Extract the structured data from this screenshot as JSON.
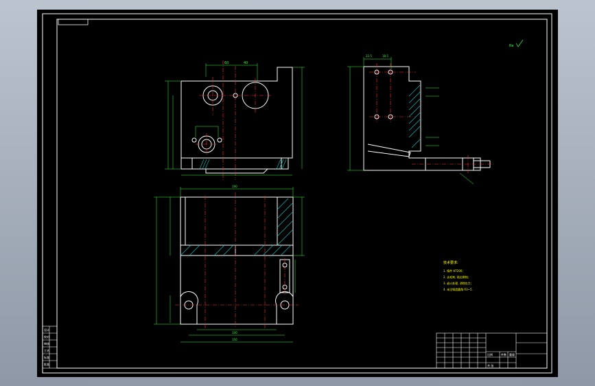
{
  "colors": {
    "background": "#000000",
    "frame": "#ffffff",
    "outline": "#ffffff",
    "dimension": "#33ff33",
    "centerline": "#ff3333",
    "hatch": "#00cccc",
    "notes": "#ffff00"
  },
  "dimension_texts": {
    "top_width": "60",
    "top_dia": "40",
    "side_top_a": "22.5",
    "side_top_b": "18.5",
    "plan_overall": "190",
    "plan_bottom": "100",
    "plan_bottom2": "150",
    "roughness_mark": "Ra"
  },
  "notes": {
    "title": "技术要求:",
    "items": [
      "1. 铸件 HT200;",
      "2. 去毛刺, 锐边倒钝;",
      "3. 退火处理, 消除应力;",
      "4. 未注铸造圆角 R3~5."
    ]
  },
  "title_block": {
    "scale_label": "比例",
    "qty_label": "件数",
    "weight_label": "重量",
    "sheet_label": "共 张"
  },
  "revision_block": {
    "labels": [
      "设计",
      "校对",
      "审核",
      "工艺",
      "标准",
      "批准"
    ]
  }
}
